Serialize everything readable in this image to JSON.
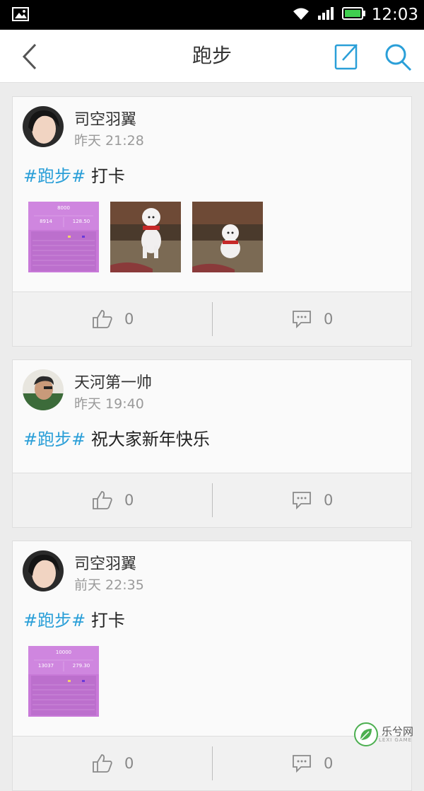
{
  "status_bar": {
    "time": "12:03"
  },
  "header": {
    "title": "跑步"
  },
  "posts": [
    {
      "user": "司空羽翼",
      "time": "昨天 21:28",
      "tag": "#跑步#",
      "text": "打卡",
      "images": [
        {
          "kind": "screenshot",
          "goal": "8000",
          "steps": "8914",
          "distance": "128.50"
        },
        {
          "kind": "photo",
          "subject": "white poodle dog"
        },
        {
          "kind": "photo",
          "subject": "white poodle dog"
        }
      ],
      "likes": "0",
      "comments": "0"
    },
    {
      "user": "天河第一帅",
      "time": "昨天 19:40",
      "tag": "#跑步#",
      "text": "祝大家新年快乐",
      "images": [],
      "likes": "0",
      "comments": "0"
    },
    {
      "user": "司空羽翼",
      "time": "前天 22:35",
      "tag": "#跑步#",
      "text": "打卡",
      "images": [
        {
          "kind": "screenshot",
          "goal": "10000",
          "steps": "13037",
          "distance": "279.30"
        }
      ],
      "likes": "0",
      "comments": "0"
    }
  ],
  "watermark": {
    "text": "乐兮网",
    "sub": "LEXI GAME"
  },
  "colors": {
    "tag": "#2a9fd8",
    "accent_icon": "#2a9fd8",
    "card_bg": "#fafafa",
    "page_bg": "#ececec"
  }
}
